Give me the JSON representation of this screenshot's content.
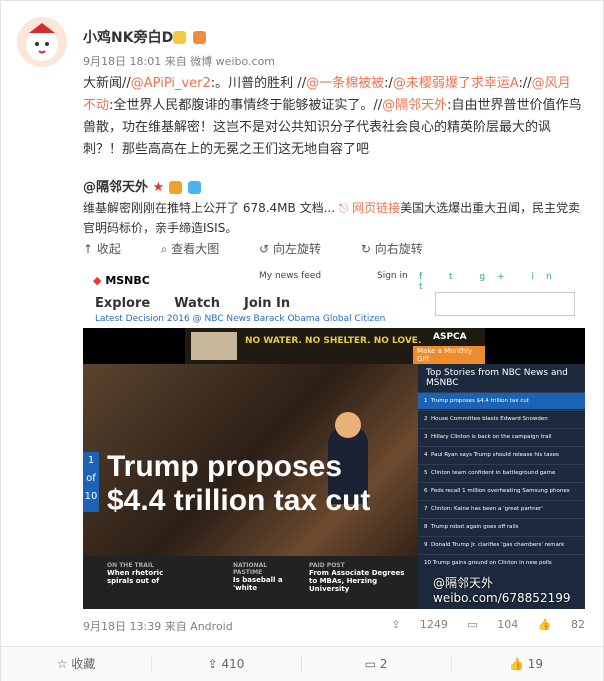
{
  "post": {
    "username": "小鸡NK旁白D",
    "time": "9月18日 18:01 来自 微博 weibo.com",
    "content": {
      "p1": "大新闻//",
      "l1": "@APiPi_ver2",
      "p2": ":。川普的胜利 //",
      "l2": "@一条棉被被",
      "p3": ":/",
      "l3": "@未樱弱爆了求幸运A",
      "p4": "://",
      "l4": "@风月不动",
      "p5": ":全世界人民都腹诽的事情终于能够被证实了。//",
      "l5": "@隔邻天外",
      "p6": ":自由世界普世价值作鸟兽散，功在维基解密！这岂不是对公共知识分子代表社会良心的精英阶层最大的讽刺？！那些高高在上的无冕之王们这无地自容了吧"
    }
  },
  "repost": {
    "username": "@隔邻天外",
    "text_a": "维基解密刚刚在推特上公开了 678.4MB 文档... ",
    "link_label": "网页链接",
    "text_b": "美国大选爆出重大丑闻，民主党卖官明码标价，亲手缔造ISIS。",
    "tools": [
      "收起",
      "查看大图",
      "向左旋转",
      "向右旋转"
    ],
    "time": "9月18日 13:39 来自 Android",
    "reposts": "1249",
    "comments": "104",
    "likes": "82"
  },
  "screenshot": {
    "logo": "MSNBC",
    "my_news": "My news feed",
    "sign_in": "Sign in",
    "nav": [
      "Explore",
      "Watch",
      "Join In"
    ],
    "latest": "Latest  Decision 2016 @ NBC News  Barack Obama  Global Citizen",
    "ad_text": "NO WATER. NO SHELTER. NO LOVE.",
    "ad_brand": "ASPCA",
    "ad_btn": "Make a Monthly Gift",
    "headline_1": "Trump proposes",
    "headline_2": "$4.4 trillion tax cut",
    "slide_num": "1",
    "slide_of": "of",
    "slide_total": "10",
    "stories_title": "Top Stories from NBC News and MSNBC",
    "stories": [
      "Trump proposes $4.4 trillion tax cut",
      "House Committee blasts Edward Snowden",
      "Hillary Clinton is back on the campaign trail",
      "Paul Ryan says Trump should release his taxes",
      "Clinton team confident in battleground game",
      "Feds recall 1 million overheating Samsung phones",
      "Clinton: Kaine has been a 'great partner'",
      "Trump robot again goes off rails",
      "Donald Trump Jr. clarifies 'gas chambers' remark",
      "Trump gains ground on Clinton in new polls"
    ],
    "bottom_a_cap": "ON THE TRAIL",
    "bottom_a": "When rhetoric spirals out of",
    "bottom_b_cap": "NATIONAL PASTIME",
    "bottom_b": "Is baseball a 'white",
    "bottom_c_cap": "PAID POST",
    "bottom_c": "From Associate Degrees to MBAs, Herzing University",
    "watermark": "@隔邻天外 weibo.com/678852199"
  },
  "footer": {
    "favorite": "收藏",
    "repost": "410",
    "comment": "2",
    "like": "19"
  }
}
